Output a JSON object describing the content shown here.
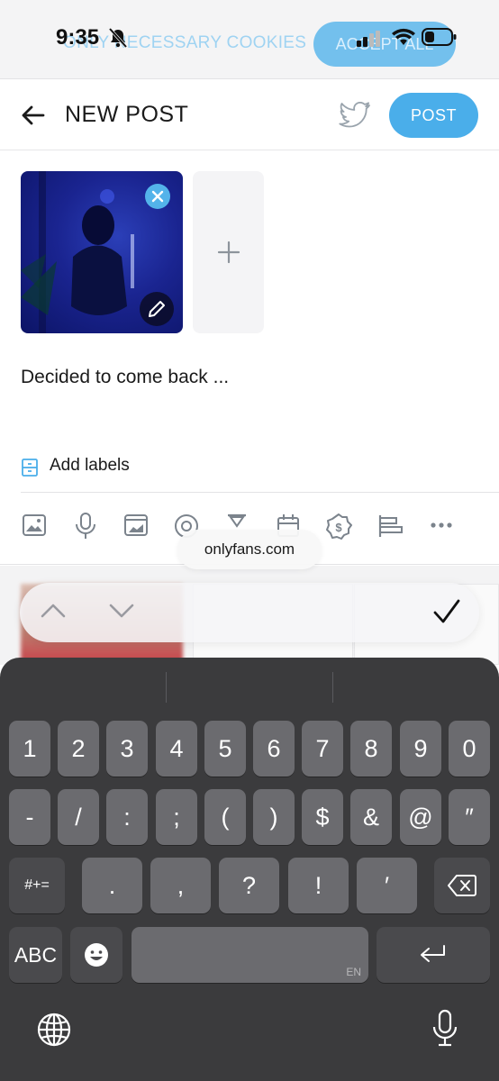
{
  "status_bar": {
    "time": "9:35"
  },
  "cookie_banner": {
    "necessary_label": "ONLY NECESSARY COOKIES",
    "accept_label": "ACCEPT ALL"
  },
  "header": {
    "title": "NEW POST",
    "post_label": "POST"
  },
  "composer": {
    "text": "Decided to come back ...",
    "add_labels": "Add labels",
    "url_pill": "onlyfans.com"
  },
  "toolbar_icons": [
    "image-icon",
    "microphone-icon",
    "vault-icon",
    "poll-icon",
    "timer-icon",
    "calendar-icon",
    "price-icon",
    "text-format-icon",
    "more-icon"
  ],
  "keyboard": {
    "row1": [
      "1",
      "2",
      "3",
      "4",
      "5",
      "6",
      "7",
      "8",
      "9",
      "0"
    ],
    "row2": [
      "-",
      "/",
      ":",
      ";",
      "(",
      ")",
      "$",
      "&",
      "@",
      "″"
    ],
    "row3_mode": "#+=",
    "row3": [
      ".",
      ",",
      "?",
      "!",
      "′"
    ],
    "abc_label": "ABC",
    "space_lang": "EN"
  },
  "colors": {
    "accent": "#4aaeea",
    "keyboard_bg": "#3b3b3d",
    "key_bg": "#6b6b6f"
  }
}
